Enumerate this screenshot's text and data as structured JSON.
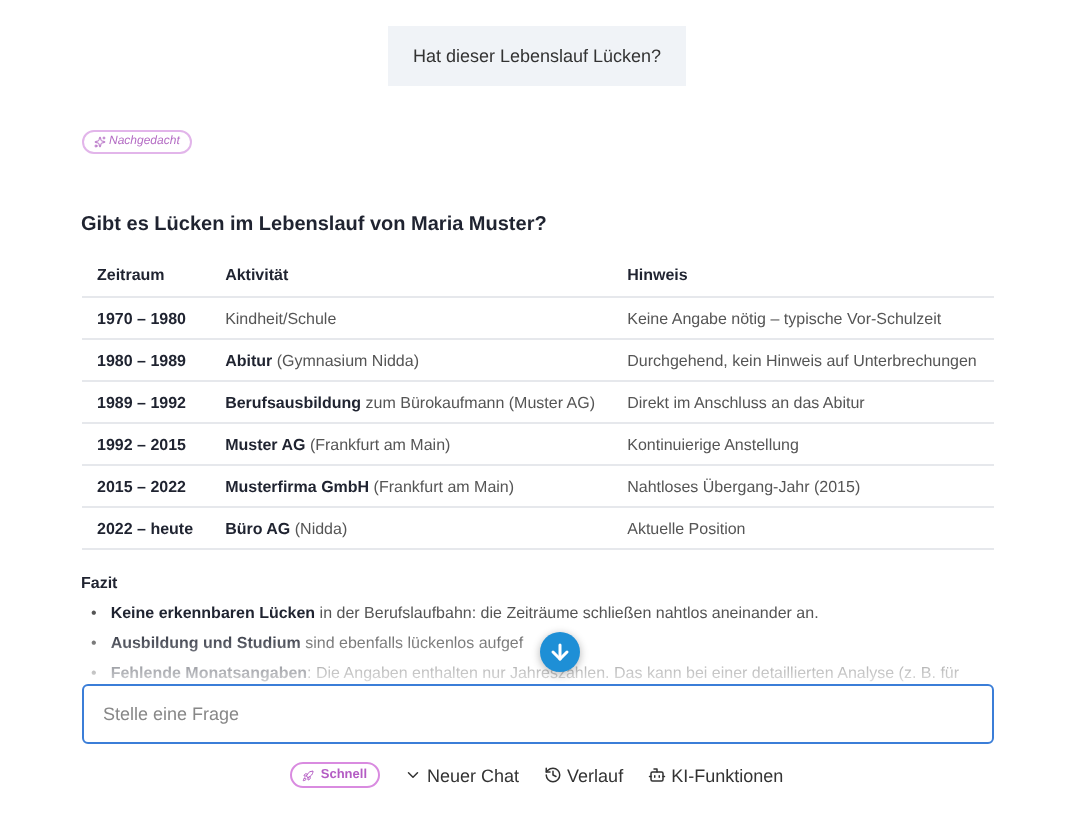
{
  "question": "Hat dieser Lebenslauf Lücken?",
  "badge": "Nachgedacht",
  "heading": "Gibt es Lücken im Lebenslauf von Maria Muster?",
  "table": {
    "columns": [
      "Zeitraum",
      "Aktivität",
      "Hinweis"
    ],
    "rows": [
      [
        "1970 – 1980",
        "Kindheit/Schule",
        "Keine Angabe nötig – typische Vor-Schulzeit"
      ],
      [
        "1980 – 1989",
        "**Abitur** (Gymnasium Nidda)",
        "Durchgehend, kein Hinweis auf Unterbrechungen"
      ],
      [
        "1989 – 1992",
        "**Berufsausbildung** zum Bürokaufmann (Muster AG)",
        "Direkt im Anschluss an das Abitur"
      ],
      [
        "1992 – 2015",
        "**Muster AG** (Frankfurt am Main)",
        "Kontinuierige Anstellung"
      ],
      [
        "2015 – 2022",
        "**Musterfirma GmbH** (Frankfurt am Main)",
        "Nahtloses Übergang-Jahr (2015)"
      ],
      [
        "2022 – heute",
        "**Büro AG** (Nidda)",
        "Aktuelle Position"
      ]
    ]
  },
  "summary": {
    "title": "Fazit",
    "items": [
      {
        "bullet": "•",
        "text": "**Keine erkennbaren Lücken** in der Berufslaufbahn: die Zeiträume schließen nahtlos aneinander an."
      },
      {
        "bullet": "•",
        "text": "**Ausbildung und Studium** sind ebenfalls lückenlos aufgef"
      },
      {
        "bullet": "•",
        "text": "**Fehlende Monatsangaben**: Die Angaben enthalten nur Jahreszahlen. Das kann bei einer detaillierten Analyse (z. B. für"
      }
    ]
  },
  "input": {
    "placeholder": "Stelle eine Frage"
  },
  "toolbar": [
    {
      "kind": "mode",
      "label": "Schnell"
    },
    {
      "kind": "new",
      "label": "Neuer Chat"
    },
    {
      "kind": "history",
      "label": "Verlauf"
    },
    {
      "kind": "tools",
      "label": "KI-Funktionen"
    }
  ]
}
